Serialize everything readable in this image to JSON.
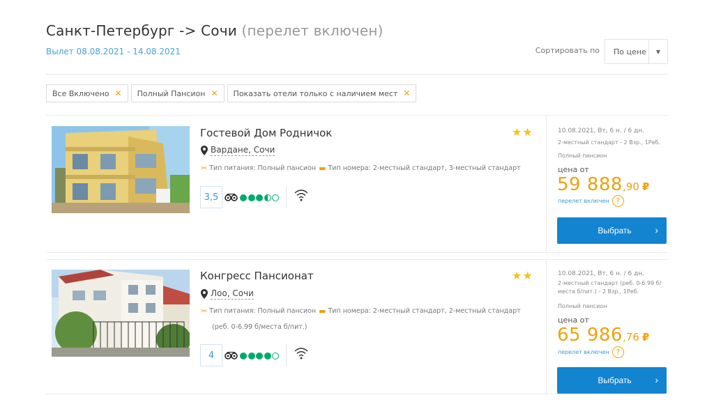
{
  "header": {
    "route": "Санкт-Петербург -> Сочи",
    "note": "(перелет включен)",
    "dates": "Вылет 08.08.2021 - 14.08.2021"
  },
  "sort": {
    "label": "Сортировать по",
    "value": "По цене"
  },
  "filters": [
    {
      "label": "Все Включено"
    },
    {
      "label": "Полный Пансион"
    },
    {
      "label": "Показать отели только с наличием мест"
    }
  ],
  "hotels": [
    {
      "name": "Гостевой Дом Родничок",
      "stars": "★★",
      "location": "Вардане, Сочи",
      "meal": "Тип питания: Полный пансион",
      "room": "Тип номера: 2-местный стандарт, 3-местный стандарт",
      "room_cont": "",
      "rating": "3,5",
      "ta_bubbles": 3.5,
      "offer_date": "10.08.2021, Вт, 6 н. / 6 дн.",
      "offer_room": "2-местный стандарт - 2 Взр., 1Реб.",
      "offer_meal": "Полный пансион",
      "price_from": "цена от",
      "price_main": "59 888",
      "price_cents": ",90",
      "currency": "₽",
      "flight": "перелет включен",
      "help": "?",
      "button": "Выбрать"
    },
    {
      "name": "Конгресс Пансионат",
      "stars": "★★",
      "location": "Лоо, Сочи",
      "meal": "Тип питания: Полный пансион",
      "room": "Тип номера: 2-местный стандарт, 2-местный стандарт",
      "room_cont": "(реб. 0-6.99 б/места б/пит.)",
      "rating": "4",
      "ta_bubbles": 4,
      "offer_date": "10.08.2021, Вт, 6 н. / 6 дн.",
      "offer_room": "2-местный стандарт (реб. 0-6.99 б/места б/пит.) - 2 Взр., 1Реб.",
      "offer_meal": "Полный пансион",
      "price_from": "цена от",
      "price_main": "65 986",
      "price_cents": ",76",
      "currency": "₽",
      "flight": "перелет включен",
      "help": "?",
      "button": "Выбрать"
    }
  ],
  "colors": {
    "accent": "#1384cf",
    "price": "#f0a10d",
    "tripadvisor": "#00aa6c",
    "link": "#4aa3d8"
  }
}
